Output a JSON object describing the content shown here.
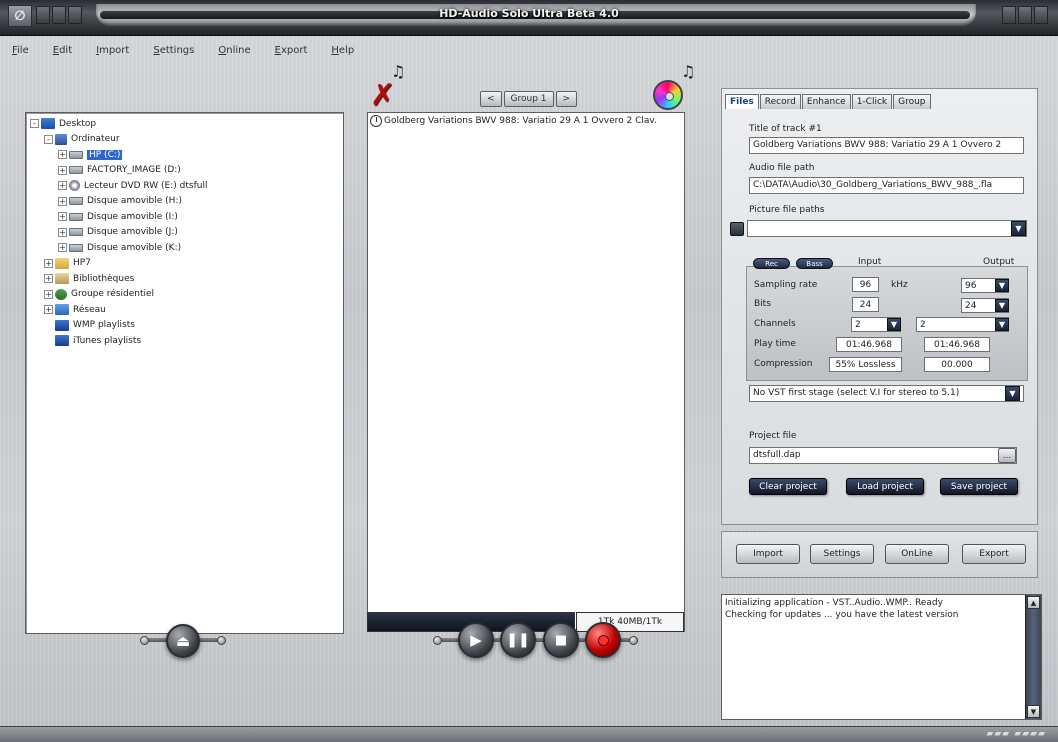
{
  "window": {
    "title": "HD-Audio Solo Ultra Beta 4.0"
  },
  "menu": [
    "File",
    "Edit",
    "Import",
    "Settings",
    "Online",
    "Export",
    "Help"
  ],
  "tree": [
    {
      "label": "Desktop",
      "level": 0,
      "expander": "-",
      "icon": "desktop"
    },
    {
      "label": "Ordinateur",
      "level": 1,
      "expander": "-",
      "icon": "computer"
    },
    {
      "label": "HP (C:)",
      "level": 2,
      "expander": "+",
      "icon": "disk",
      "selected": true
    },
    {
      "label": "FACTORY_IMAGE (D:)",
      "level": 2,
      "expander": "+",
      "icon": "disk"
    },
    {
      "label": "Lecteur DVD RW (E:) dtsfull",
      "level": 2,
      "expander": "+",
      "icon": "dvd"
    },
    {
      "label": "Disque amovible (H:)",
      "level": 2,
      "expander": "+",
      "icon": "disk"
    },
    {
      "label": "Disque amovible (I:)",
      "level": 2,
      "expander": "+",
      "icon": "disk"
    },
    {
      "label": "Disque amovible (J:)",
      "level": 2,
      "expander": "+",
      "icon": "disk"
    },
    {
      "label": "Disque amovible (K:)",
      "level": 2,
      "expander": "+",
      "icon": "disk"
    },
    {
      "label": "HP7",
      "level": 1,
      "expander": "+",
      "icon": "folder"
    },
    {
      "label": "Bibliothèques",
      "level": 1,
      "expander": "+",
      "icon": "lib"
    },
    {
      "label": "Groupe résidentiel",
      "level": 1,
      "expander": "+",
      "icon": "group"
    },
    {
      "label": "Réseau",
      "level": 1,
      "expander": "+",
      "icon": "net"
    },
    {
      "label": "WMP playlists",
      "level": 1,
      "expander": "",
      "icon": "wmp"
    },
    {
      "label": "iTunes playlists",
      "level": 1,
      "expander": "",
      "icon": "wmp"
    }
  ],
  "group_nav": {
    "prev": "<",
    "label": "Group 1",
    "next": ">"
  },
  "tracks": [
    "Goldberg Variations BWV 988: Variatio 29 A 1 Ovvero 2 Clav."
  ],
  "progress": {
    "text": "1Tk 40MB/1Tk",
    "fraction": 0.0
  },
  "tabs": [
    "Files",
    "Record",
    "Enhance",
    "1-Click",
    "Group"
  ],
  "active_tab": "Files",
  "files": {
    "title_label": "Title of track #1",
    "title_value": "Goldberg Variations BWV 988: Variatio 29 A 1 Ovvero 2",
    "audio_path_label": "Audio file path",
    "audio_path_value": "C:\\DATA\\Audio\\30_Goldberg_Variations_BWV_988_.fla",
    "picture_label": "Picture file paths",
    "picture_value": ""
  },
  "audio": {
    "pill_left": "Rec",
    "pill_right": "Bass",
    "input_header": "Input",
    "output_header": "Output",
    "sampling_label": "Sampling rate",
    "sampling_in": "96",
    "sampling_unit": "kHz",
    "sampling_out": "96",
    "bits_label": "Bits",
    "bits_in": "24",
    "bits_out": "24",
    "channels_label": "Channels",
    "channels_in": "2",
    "channels_out": "2",
    "playtime_label": "Play time",
    "playtime_in": "01:46.968",
    "playtime_out": "01:46.968",
    "compression_label": "Compression",
    "compression_in": "55% Lossless",
    "compression_out": "00.000",
    "vst_select": "No VST first stage (select V.I for stereo to 5.1)"
  },
  "project": {
    "label": "Project file",
    "value": "dtsfull.dap",
    "browse": "...",
    "clear": "Clear project",
    "load": "Load project",
    "save": "Save project"
  },
  "actions": {
    "import": "Import",
    "settings": "Settings",
    "online": "OnLine",
    "export": "Export"
  },
  "log": [
    "Initializing application - VST..Audio..WMP.. Ready",
    "Checking for updates ... you have the latest version"
  ],
  "icons": {
    "clear_list": "x-icon",
    "burn": "cd-icon",
    "eject": "eject-icon",
    "play": "play-icon",
    "pause": "pause-icon",
    "stop": "stop-icon",
    "record": "record-icon"
  },
  "colors": {
    "selection": "#3366cc",
    "record": "#c10000",
    "clear": "#b10d0d"
  }
}
